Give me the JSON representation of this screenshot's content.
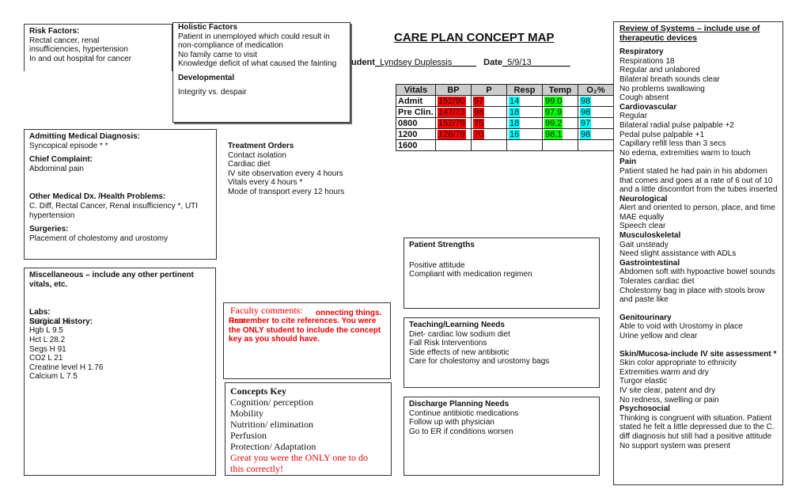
{
  "title": "CARE PLAN CONCEPT MAP",
  "student_label": "udent",
  "student_value": "_Lyndsey Duplessis_____",
  "date_label": "Date",
  "date_value": "_5/9/13________",
  "risk": {
    "heading": "Risk Factors:",
    "lines": [
      "Rectal cancer, renal",
      "insufficiencies, hypertension",
      "In and out hospital for cancer"
    ]
  },
  "holistic": {
    "heading": "Holistic Factors",
    "lines": [
      "Patient in unemployed which could result in",
      "non-compliance of medication",
      "No family came to visit",
      "Knowledge deficit of what caused the fainting"
    ],
    "dev_heading": "Developmental",
    "dev_text": "Integrity vs. despair"
  },
  "vitals": {
    "headers": [
      "Vitals",
      "BP",
      "P",
      "Resp",
      "Temp",
      "O₂%"
    ],
    "rows": [
      [
        "Admit",
        "152/90",
        "97",
        "14",
        "99.0",
        "98"
      ],
      [
        "Pre Clin.",
        "147/73",
        "98",
        "18",
        "97.9",
        "98"
      ],
      [
        "0800",
        "152/79",
        "75",
        "18",
        "99.2",
        "97"
      ],
      [
        "1200",
        "126/79",
        "70",
        "16",
        "98.1",
        "98"
      ],
      [
        "1600",
        "",
        "",
        "",
        "",
        ""
      ]
    ],
    "colors": {
      "bp": "#ff0000",
      "p": "#ff0000",
      "resp": "#00ffff",
      "temp": "#00ff00",
      "o2": "#00ffff"
    }
  },
  "admit": {
    "dx_heading": "Admitting Medical Diagnosis:",
    "dx": "Syncopical episode * *",
    "cc_heading": "Chief Complaint:",
    "cc": "Abdominal pain",
    "other_heading": "Other Medical Dx. /Health Problems:",
    "other": [
      "C. Diff, Rectal Cancer, Renal insufficiency *, UTI",
      "hypertension"
    ],
    "surg_heading": "Surgeries:",
    "surg": "Placement of cholestomy and urostomy"
  },
  "treatment": {
    "heading": "Treatment Orders",
    "lines": [
      "Contact isolation",
      "Cardiac diet",
      "IV site observation every 4 hours",
      "Vitals every 4 hours *",
      "Mode of transport every 12 hours"
    ]
  },
  "misc": {
    "heading": "Miscellaneous – include any other pertinent",
    "heading2": "vitals, etc.",
    "labs_heading": "Labs:",
    "surg_hist": "Surgical History:",
    "overlap": "RBC L 3.14",
    "labs": [
      "Hgb L 9.5",
      "Hct L 28.2",
      "Segs H 91",
      "CO2 L 21",
      "Creatine level H 1.76",
      "Calcium L 7.5"
    ]
  },
  "faculty": {
    "heading": "Faculty comments:",
    "overlap": "Great",
    "line1": "onnecting things.",
    "lines": [
      "Remember to cite references.  You were",
      "the ONLY student to include the concept",
      "key as you should have."
    ]
  },
  "concepts": {
    "heading": "Concepts Key",
    "items": [
      "Cognition/ perception",
      "Mobility",
      "Nutrition/ elimination",
      "Perfusion",
      "Protection/ Adaptation"
    ],
    "comment": [
      "Great you were the ONLY one to do",
      "this correctly!"
    ]
  },
  "strengths": {
    "heading": "Patient Strengths",
    "lines": [
      "Positive attitude",
      "Compliant with medication regimen"
    ]
  },
  "teaching": {
    "heading": "Teaching/Learning Needs",
    "lines": [
      "Diet- cardiac low sodium diet",
      "Fall Risk Interventions",
      "Side effects of new antibiotic",
      "Care for cholestomy and urostomy bags"
    ]
  },
  "discharge": {
    "heading": "Discharge Planning Needs",
    "lines": [
      "Continue antibiotic medications",
      "Follow up with physician",
      "Go to ER if conditions worsen"
    ]
  },
  "ros": {
    "heading": "Review of Systems – include use of therapeutic devices",
    "sections": [
      {
        "h": "Respiratory",
        "lines": [
          "Respirations 18",
          "Regular and unlabored",
          "Bilateral breath sounds clear",
          "No problems swallowing",
          "Cough absent"
        ]
      },
      {
        "h": "Cardiovascular",
        "lines": [
          "Regular",
          "Bilateral radial pulse palpable +2",
          "Pedal pulse palpable +1",
          "Capillary refill less than 3 secs",
          "No edema, extremities warm to touch"
        ]
      },
      {
        "h": "Pain",
        "lines": [
          "Patient stated he had pain in his abdomen",
          "that comes and goes at a rate of 6 out of 10",
          "and a little discomfort from the tubes inserted"
        ]
      },
      {
        "h": "Neurological",
        "lines": [
          "Alert and oriented to person, place, and time",
          "MAE equally",
          "Speech clear"
        ]
      },
      {
        "h": "Musculoskeletal",
        "lines": [
          "Gait unsteady",
          "Need slight assistance with ADLs"
        ]
      },
      {
        "h": "Gastrointestinal",
        "lines": [
          "Abdomen soft with hypoactive bowel sounds",
          "Tolerates cardiac diet",
          "Cholestomy bag in place with stools brow",
          "and paste like"
        ]
      },
      {
        "h": "Genitourinary",
        "lines": [
          "Able to void with Urostomy in place",
          "Urine yellow and clear"
        ],
        "gap": true
      },
      {
        "h": "Skin/Mucosa-include IV site assessment *",
        "lines": [
          "Skin color appropriate to ethnicity",
          "Extremities warm and dry",
          "Turgor elastic",
          "IV site clear, patent and dry",
          "No redness, swelling or pain"
        ],
        "gap": true
      },
      {
        "h": "Psychosocial",
        "lines": [
          "Thinking is congruent with situation. Patient",
          "stated he felt a little depressed due to the C.",
          "diff diagnosis but still had a positive attitude",
          "No support system was present"
        ]
      }
    ]
  }
}
